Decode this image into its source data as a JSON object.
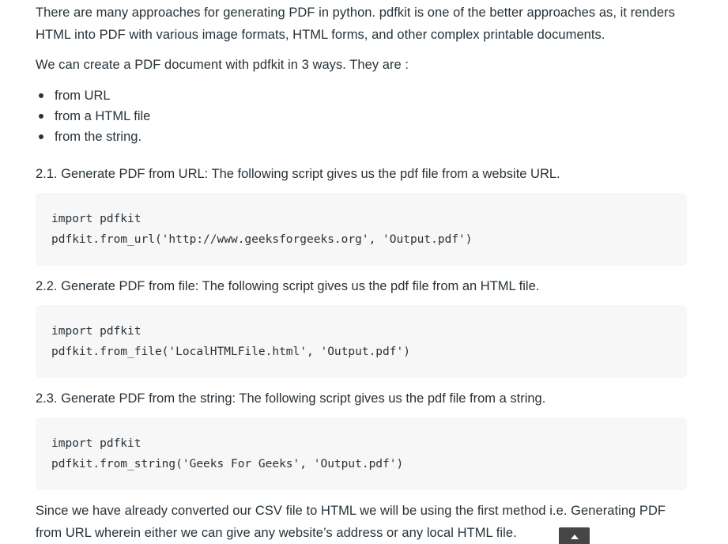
{
  "article": {
    "intro_paragraph": "There are many approaches for generating PDF in python. pdfkit is one of the better approaches as, it renders HTML into PDF with various image formats, HTML forms, and other complex printable documents.",
    "ways_paragraph": "We can create a PDF document with pdfkit in 3 ways. They are :",
    "ways": [
      "from URL",
      "from a HTML file",
      "from the string."
    ],
    "methods": [
      {
        "heading": "2.1. Generate PDF from URL: The following script gives us the pdf file from a website URL.",
        "code": [
          "import pdfkit",
          "pdfkit.from_url('http://www.geeksforgeeks.org', 'Output.pdf')"
        ]
      },
      {
        "heading": "2.2. Generate PDF from file: The following script gives us the pdf file from an HTML file.",
        "code": [
          "import pdfkit",
          "pdfkit.from_file('LocalHTMLFile.html', 'Output.pdf')"
        ]
      },
      {
        "heading": "2.3. Generate PDF from the string: The following script gives us the pdf file from a string.",
        "code": [
          "import pdfkit",
          "pdfkit.from_string('Geeks For Geeks', 'Output.pdf')"
        ]
      }
    ],
    "final_paragraph": "Since we have already converted our CSV file to HTML we will be using the first method i.e. Generating PDF from URL wherein either we can give any website’s address or any local HTML file."
  },
  "scroll_top": {
    "icon": "arrow-up-icon"
  },
  "colors": {
    "text": "#273239",
    "code_background": "#f7f7f7",
    "scroll_button": "#464646"
  }
}
